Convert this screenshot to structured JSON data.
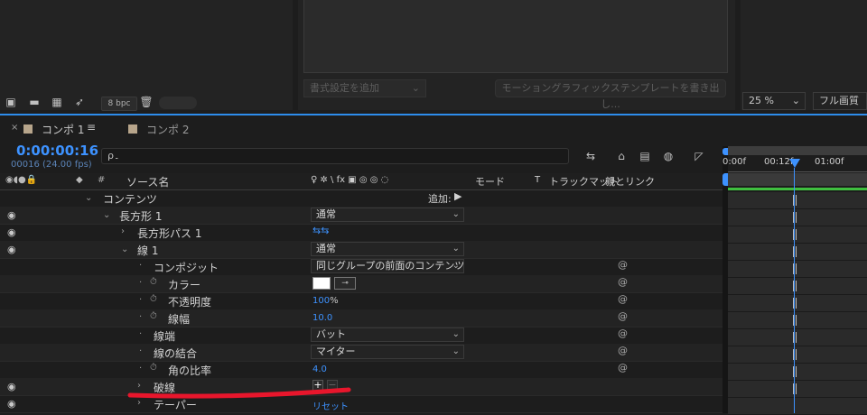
{
  "project_panel": {
    "bpc_label": "8 bpc"
  },
  "render_panel": {
    "format_button": "書式設定を追加",
    "motion_button": "モーショングラフィックステンプレートを書き出し..."
  },
  "viewer": {
    "zoom_label": "25 %",
    "quality_label": "フル画質"
  },
  "timeline": {
    "tabs": [
      {
        "label": "コンポ 1",
        "active": true
      },
      {
        "label": "コンポ 2",
        "active": false
      }
    ],
    "timecode": "0:00:00:16",
    "frame_info": "00016 (24.00 fps)",
    "search_placeholder": "ρ۔",
    "columns": {
      "hash": "#",
      "source_name": "ソース名",
      "switches": "♀ ✲ \\ fx ▣ ◎ ◎ ◌",
      "mode": "モード",
      "t": "T",
      "track_matte": "トラックマット",
      "parent": "親とリンク"
    },
    "ruler": [
      "0:00f",
      "00:12f",
      "01:00f"
    ],
    "rows": [
      {
        "name": "コンテンツ",
        "add_label": "追加:"
      },
      {
        "name": "長方形 1",
        "value": "通常"
      },
      {
        "name": "長方形パス 1"
      },
      {
        "name": "線 1",
        "value": "通常"
      },
      {
        "name": "コンポジット",
        "value": "同じグループの前面のコンテンツ"
      },
      {
        "name": "カラー"
      },
      {
        "name": "不透明度",
        "value": "100",
        "unit": "%"
      },
      {
        "name": "線幅",
        "value": "10.0"
      },
      {
        "name": "線端",
        "value": "バット"
      },
      {
        "name": "線の結合",
        "value": "マイター"
      },
      {
        "name": "角の比率",
        "value": "4.0"
      },
      {
        "name": "破線",
        "add": "+",
        "remove": "−"
      },
      {
        "name": "テーパー",
        "value": "リセット"
      }
    ]
  },
  "colors": {
    "accent": "#2d8ceb",
    "value_blue": "#3d92ff",
    "annotation_red": "#e8162c",
    "work_area_green": "#3fbf3f",
    "comp_swatch": "#b7a58b"
  }
}
